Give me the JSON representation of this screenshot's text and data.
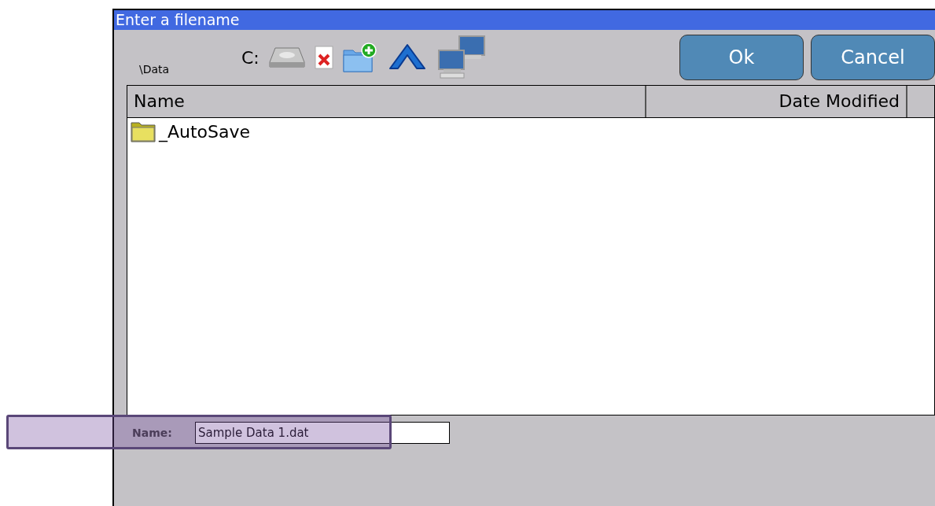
{
  "window": {
    "title": "Enter a filename"
  },
  "toolbar": {
    "path": "\\Data",
    "drive": "C:"
  },
  "buttons": [
    "Ok",
    "Cancel"
  ],
  "file_list": {
    "columns": [
      "Name",
      "Date Modified"
    ],
    "rows": [
      {
        "name": "_AutoSave",
        "kind": "folder"
      }
    ]
  },
  "name_field": {
    "label": "Name:",
    "value": "Sample Data 1.dat",
    "highlighted": true
  }
}
